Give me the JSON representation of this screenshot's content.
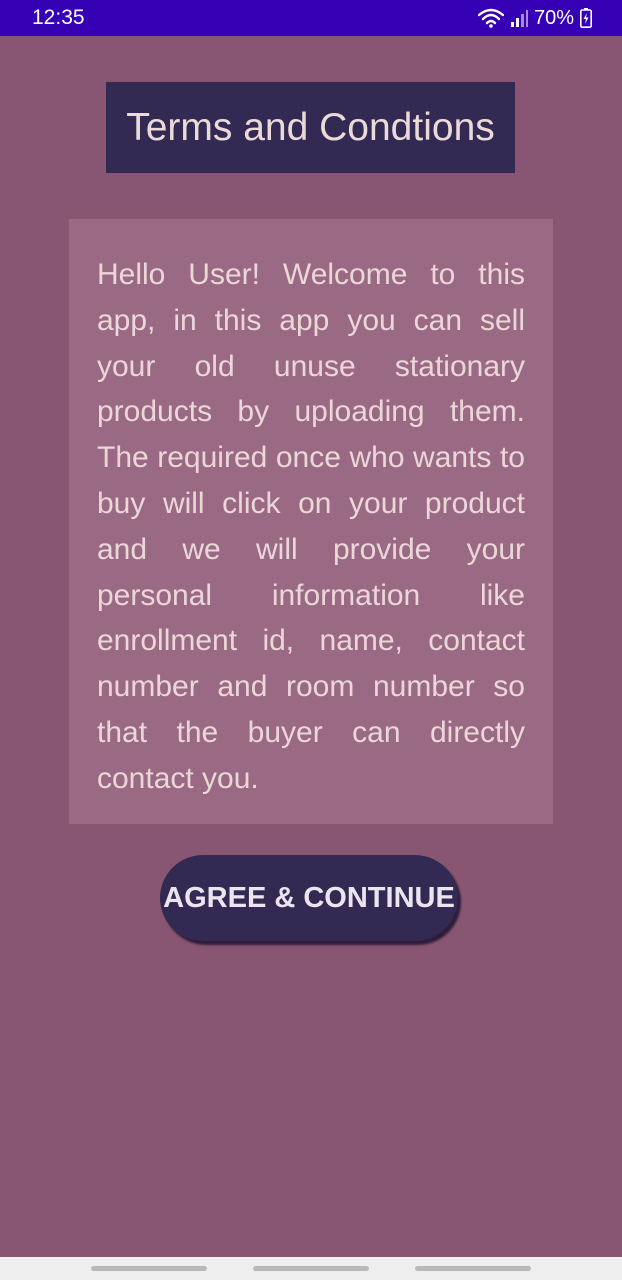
{
  "status_bar": {
    "time": "12:35",
    "battery": "70%",
    "icons": [
      "wifi-icon",
      "signal-icon",
      "battery-charging-icon"
    ],
    "background": "#3600b4"
  },
  "title": "Terms and Condtions",
  "terms_text": "Hello User! Welcome to this app, in this app you can sell your old unuse stationary products by uploading them. The required once who wants to buy will click on your product and we will provide your personal information like enrollment id, name, contact number and room number so that the buyer can directly contact you.",
  "agree_button": {
    "label": "AGREE & CONTINUE"
  },
  "colors": {
    "page_background": "#885673",
    "title_background": "#322a52",
    "card_background": "#9a6a84",
    "button_background": "#322a52",
    "text": "#ecd7d8"
  },
  "nav_bar": {
    "items": [
      "nav-recents",
      "nav-home",
      "nav-back"
    ]
  }
}
